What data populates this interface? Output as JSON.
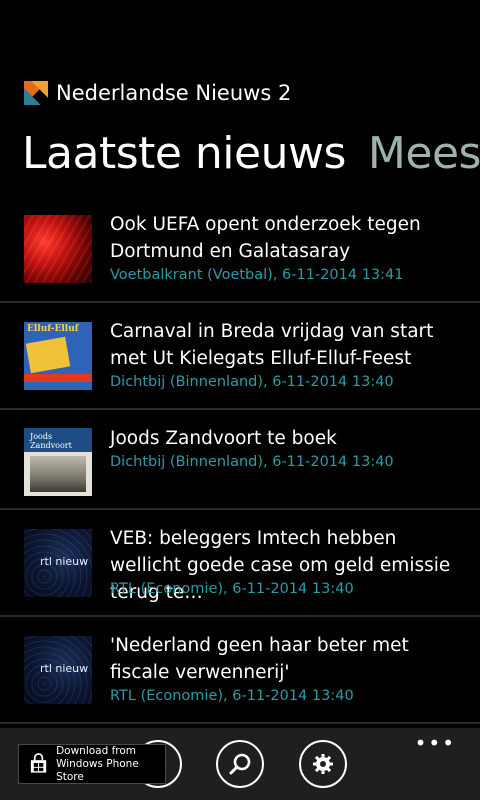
{
  "app": {
    "title": "Nederlandse Nieuws 2"
  },
  "pivot": {
    "active": "Laatste nieuws",
    "next": "Mees"
  },
  "news": [
    {
      "headline": "Ook UEFA opent onderzoek tegen Dortmund en Galatasaray",
      "meta": "Voetbalkrant (Voetbal), 6-11-2014 13:41",
      "thumb": "football-fans"
    },
    {
      "headline": "Carnaval in Breda vrijdag van start met Ut Kielegats Elluf-Elluf-Feest",
      "meta": "Dichtbij (Binnenland), 6-11-2014 13:40",
      "thumb": "carnaval-poster",
      "thumb_text": "Elluf-Elluf"
    },
    {
      "headline": "Joods Zandvoort te boek",
      "meta": "Dichtbij (Binnenland), 6-11-2014 13:40",
      "thumb": "book-cover",
      "thumb_text": "Joods Zandvoort"
    },
    {
      "headline": "VEB: beleggers Imtech hebben wellicht goede case om geld emissie terug te…",
      "meta": "RTL (Economie), 6-11-2014 13:40",
      "thumb": "rtl-nieuws",
      "thumb_text": "rtl nieuw"
    },
    {
      "headline": "'Nederland geen haar beter met fiscale verwennerij'",
      "meta": "RTL (Economie), 6-11-2014 13:40",
      "thumb": "rtl-nieuws",
      "thumb_text": "rtl nieuw"
    }
  ],
  "appbar": {
    "more": "•••",
    "buttons": [
      "refresh-icon",
      "search-icon",
      "settings-icon"
    ]
  },
  "store_badge": {
    "line1": "Download from",
    "line2": "Windows Phone Store"
  },
  "colors": {
    "background": "#000000",
    "accent": "#2b9ca6",
    "pivot_inactive": "#9fb3ad",
    "appbar": "#1f1f1f"
  }
}
